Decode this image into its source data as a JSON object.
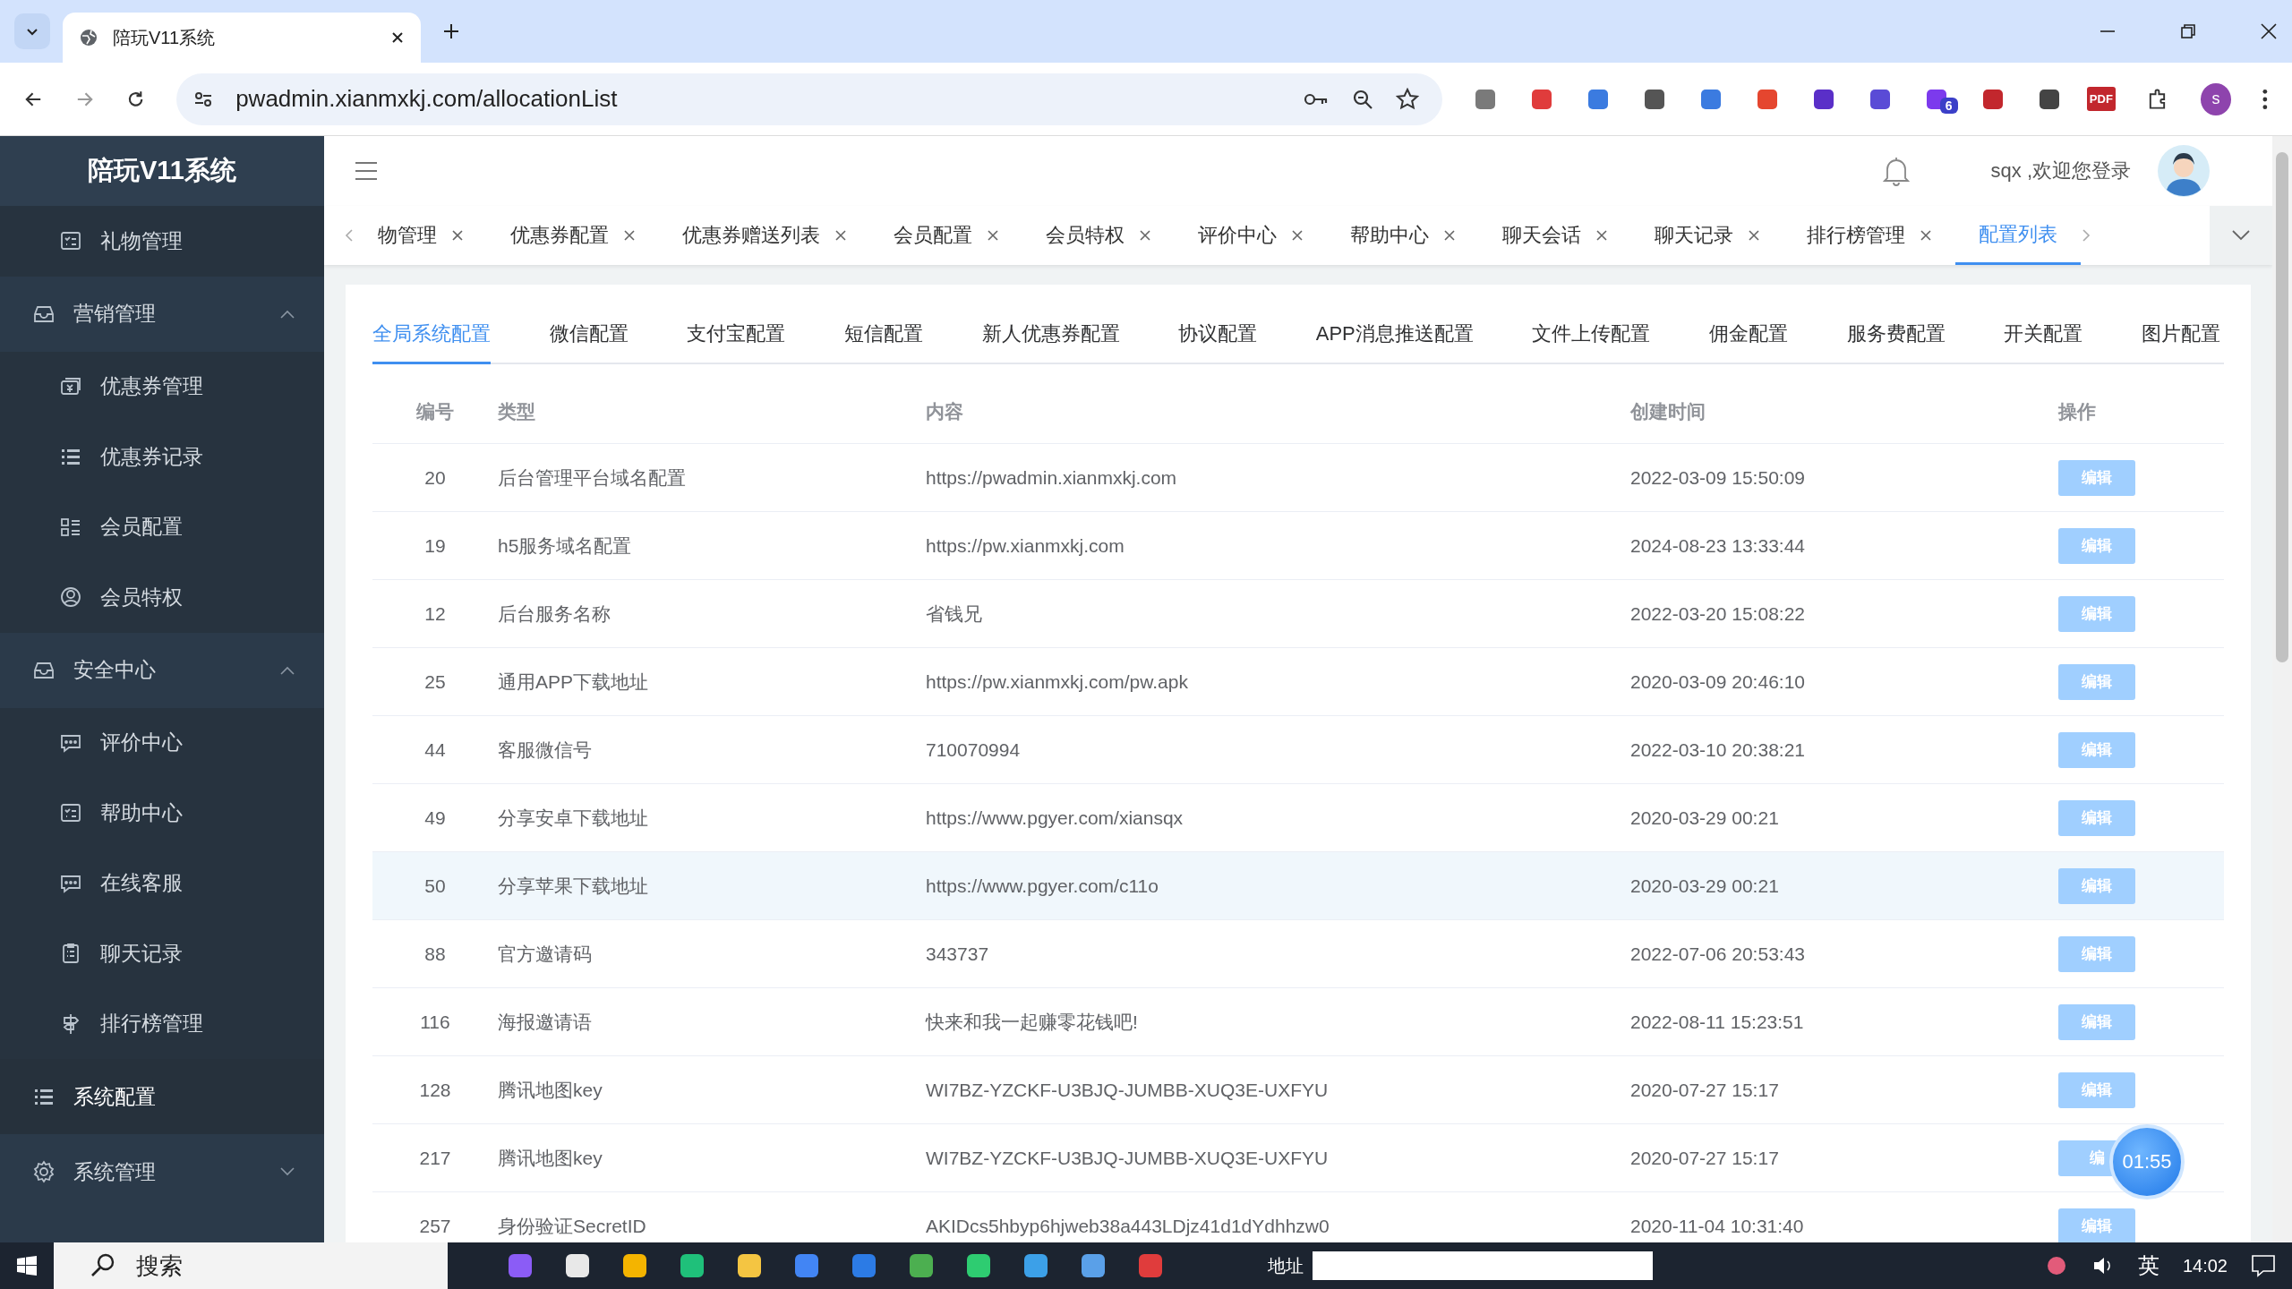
{
  "browser": {
    "tab_title": "陪玩V11系统",
    "url": "pwadmin.xianmxkj.com/allocationList",
    "extension_badge": "6",
    "pdf_label": "PDF",
    "profile": "s"
  },
  "sidebar": {
    "title": "陪玩V11系统",
    "items": [
      {
        "label": "礼物管理",
        "kind": "sub",
        "selected": false
      },
      {
        "label": "营销管理",
        "kind": "group",
        "expanded": true,
        "selected": false,
        "children": [
          {
            "label": "优惠券管理",
            "kind": "sub",
            "selected": false
          },
          {
            "label": "优惠券记录",
            "kind": "sub",
            "selected": false
          },
          {
            "label": "会员配置",
            "kind": "sub",
            "selected": false
          },
          {
            "label": "会员特权",
            "kind": "sub",
            "selected": false
          }
        ]
      },
      {
        "label": "安全中心",
        "kind": "group",
        "expanded": true,
        "selected": false,
        "children": [
          {
            "label": "评价中心",
            "kind": "sub",
            "selected": false
          },
          {
            "label": "帮助中心",
            "kind": "sub",
            "selected": false
          },
          {
            "label": "在线客服",
            "kind": "sub",
            "selected": false
          },
          {
            "label": "聊天记录",
            "kind": "sub",
            "selected": false
          },
          {
            "label": "排行榜管理",
            "kind": "sub",
            "selected": false
          }
        ]
      },
      {
        "label": "系统配置",
        "kind": "item",
        "selected": true
      },
      {
        "label": "系统管理",
        "kind": "group",
        "expanded": false,
        "selected": false
      }
    ]
  },
  "header": {
    "greeting": "sqx ,欢迎您登录"
  },
  "page_tabs": [
    {
      "label": "物管理",
      "selected": false
    },
    {
      "label": "优惠券配置",
      "selected": false
    },
    {
      "label": "优惠券赠送列表",
      "selected": false
    },
    {
      "label": "会员配置",
      "selected": false
    },
    {
      "label": "会员特权",
      "selected": false
    },
    {
      "label": "评价中心",
      "selected": false
    },
    {
      "label": "帮助中心",
      "selected": false
    },
    {
      "label": "聊天会话",
      "selected": false
    },
    {
      "label": "聊天记录",
      "selected": false
    },
    {
      "label": "排行榜管理",
      "selected": false
    },
    {
      "label": "配置列表",
      "selected": true
    }
  ],
  "config_tabs": [
    {
      "label": "全局系统配置",
      "selected": true
    },
    {
      "label": "微信配置",
      "selected": false
    },
    {
      "label": "支付宝配置",
      "selected": false
    },
    {
      "label": "短信配置",
      "selected": false
    },
    {
      "label": "新人优惠券配置",
      "selected": false
    },
    {
      "label": "协议配置",
      "selected": false
    },
    {
      "label": "APP消息推送配置",
      "selected": false
    },
    {
      "label": "文件上传配置",
      "selected": false
    },
    {
      "label": "佣金配置",
      "selected": false
    },
    {
      "label": "服务费配置",
      "selected": false
    },
    {
      "label": "开关配置",
      "selected": false
    },
    {
      "label": "图片配置",
      "selected": false
    }
  ],
  "table": {
    "columns": [
      "编号",
      "类型",
      "内容",
      "创建时间",
      "操作"
    ],
    "rows": [
      {
        "id": "20",
        "type": "后台管理平台域名配置",
        "content": "https://pwadmin.xianmxkj.com",
        "created": "2022-03-09 15:50:09",
        "action": "编辑",
        "hovered": false
      },
      {
        "id": "19",
        "type": "h5服务域名配置",
        "content": "https://pw.xianmxkj.com",
        "created": "2024-08-23 13:33:44",
        "action": "编辑",
        "hovered": false
      },
      {
        "id": "12",
        "type": "后台服务名称",
        "content": "省钱兄",
        "created": "2022-03-20 15:08:22",
        "action": "编辑",
        "hovered": false
      },
      {
        "id": "25",
        "type": "通用APP下载地址",
        "content": "https://pw.xianmxkj.com/pw.apk",
        "created": "2020-03-09 20:46:10",
        "action": "编辑",
        "hovered": false
      },
      {
        "id": "44",
        "type": "客服微信号",
        "content": "710070994",
        "created": "2022-03-10 20:38:21",
        "action": "编辑",
        "hovered": false
      },
      {
        "id": "49",
        "type": "分享安卓下载地址",
        "content": "https://www.pgyer.com/xiansqx",
        "created": "2020-03-29 00:21",
        "action": "编辑",
        "hovered": false
      },
      {
        "id": "50",
        "type": "分享苹果下载地址",
        "content": "https://www.pgyer.com/c11o",
        "created": "2020-03-29 00:21",
        "action": "编辑",
        "hovered": true
      },
      {
        "id": "88",
        "type": "官方邀请码",
        "content": "343737",
        "created": "2022-07-06 20:53:43",
        "action": "编辑",
        "hovered": false
      },
      {
        "id": "116",
        "type": "海报邀请语",
        "content": "快来和我一起赚零花钱吧!",
        "created": "2022-08-11 15:23:51",
        "action": "编辑",
        "hovered": false
      },
      {
        "id": "128",
        "type": "腾讯地图key",
        "content": "WI7BZ-YZCKF-U3BJQ-JUMBB-XUQ3E-UXFYU",
        "created": "2020-07-27 15:17",
        "action": "编辑",
        "hovered": false
      },
      {
        "id": "217",
        "type": "腾讯地图key",
        "content": "WI7BZ-YZCKF-U3BJQ-JUMBB-XUQ3E-UXFYU",
        "created": "2020-07-27 15:17",
        "action": "编",
        "hovered": false
      },
      {
        "id": "257",
        "type": "身份验证SecretID",
        "content": "AKIDcs5hbyp6hjweb38a443LDjz41d1dYdhhzw0",
        "created": "2020-11-04 10:31:40",
        "action": "编辑",
        "hovered": false
      }
    ]
  },
  "timer": "01:55",
  "taskbar": {
    "search": "搜索",
    "address_label": "地址",
    "ime": "英",
    "clock": "14:02"
  }
}
